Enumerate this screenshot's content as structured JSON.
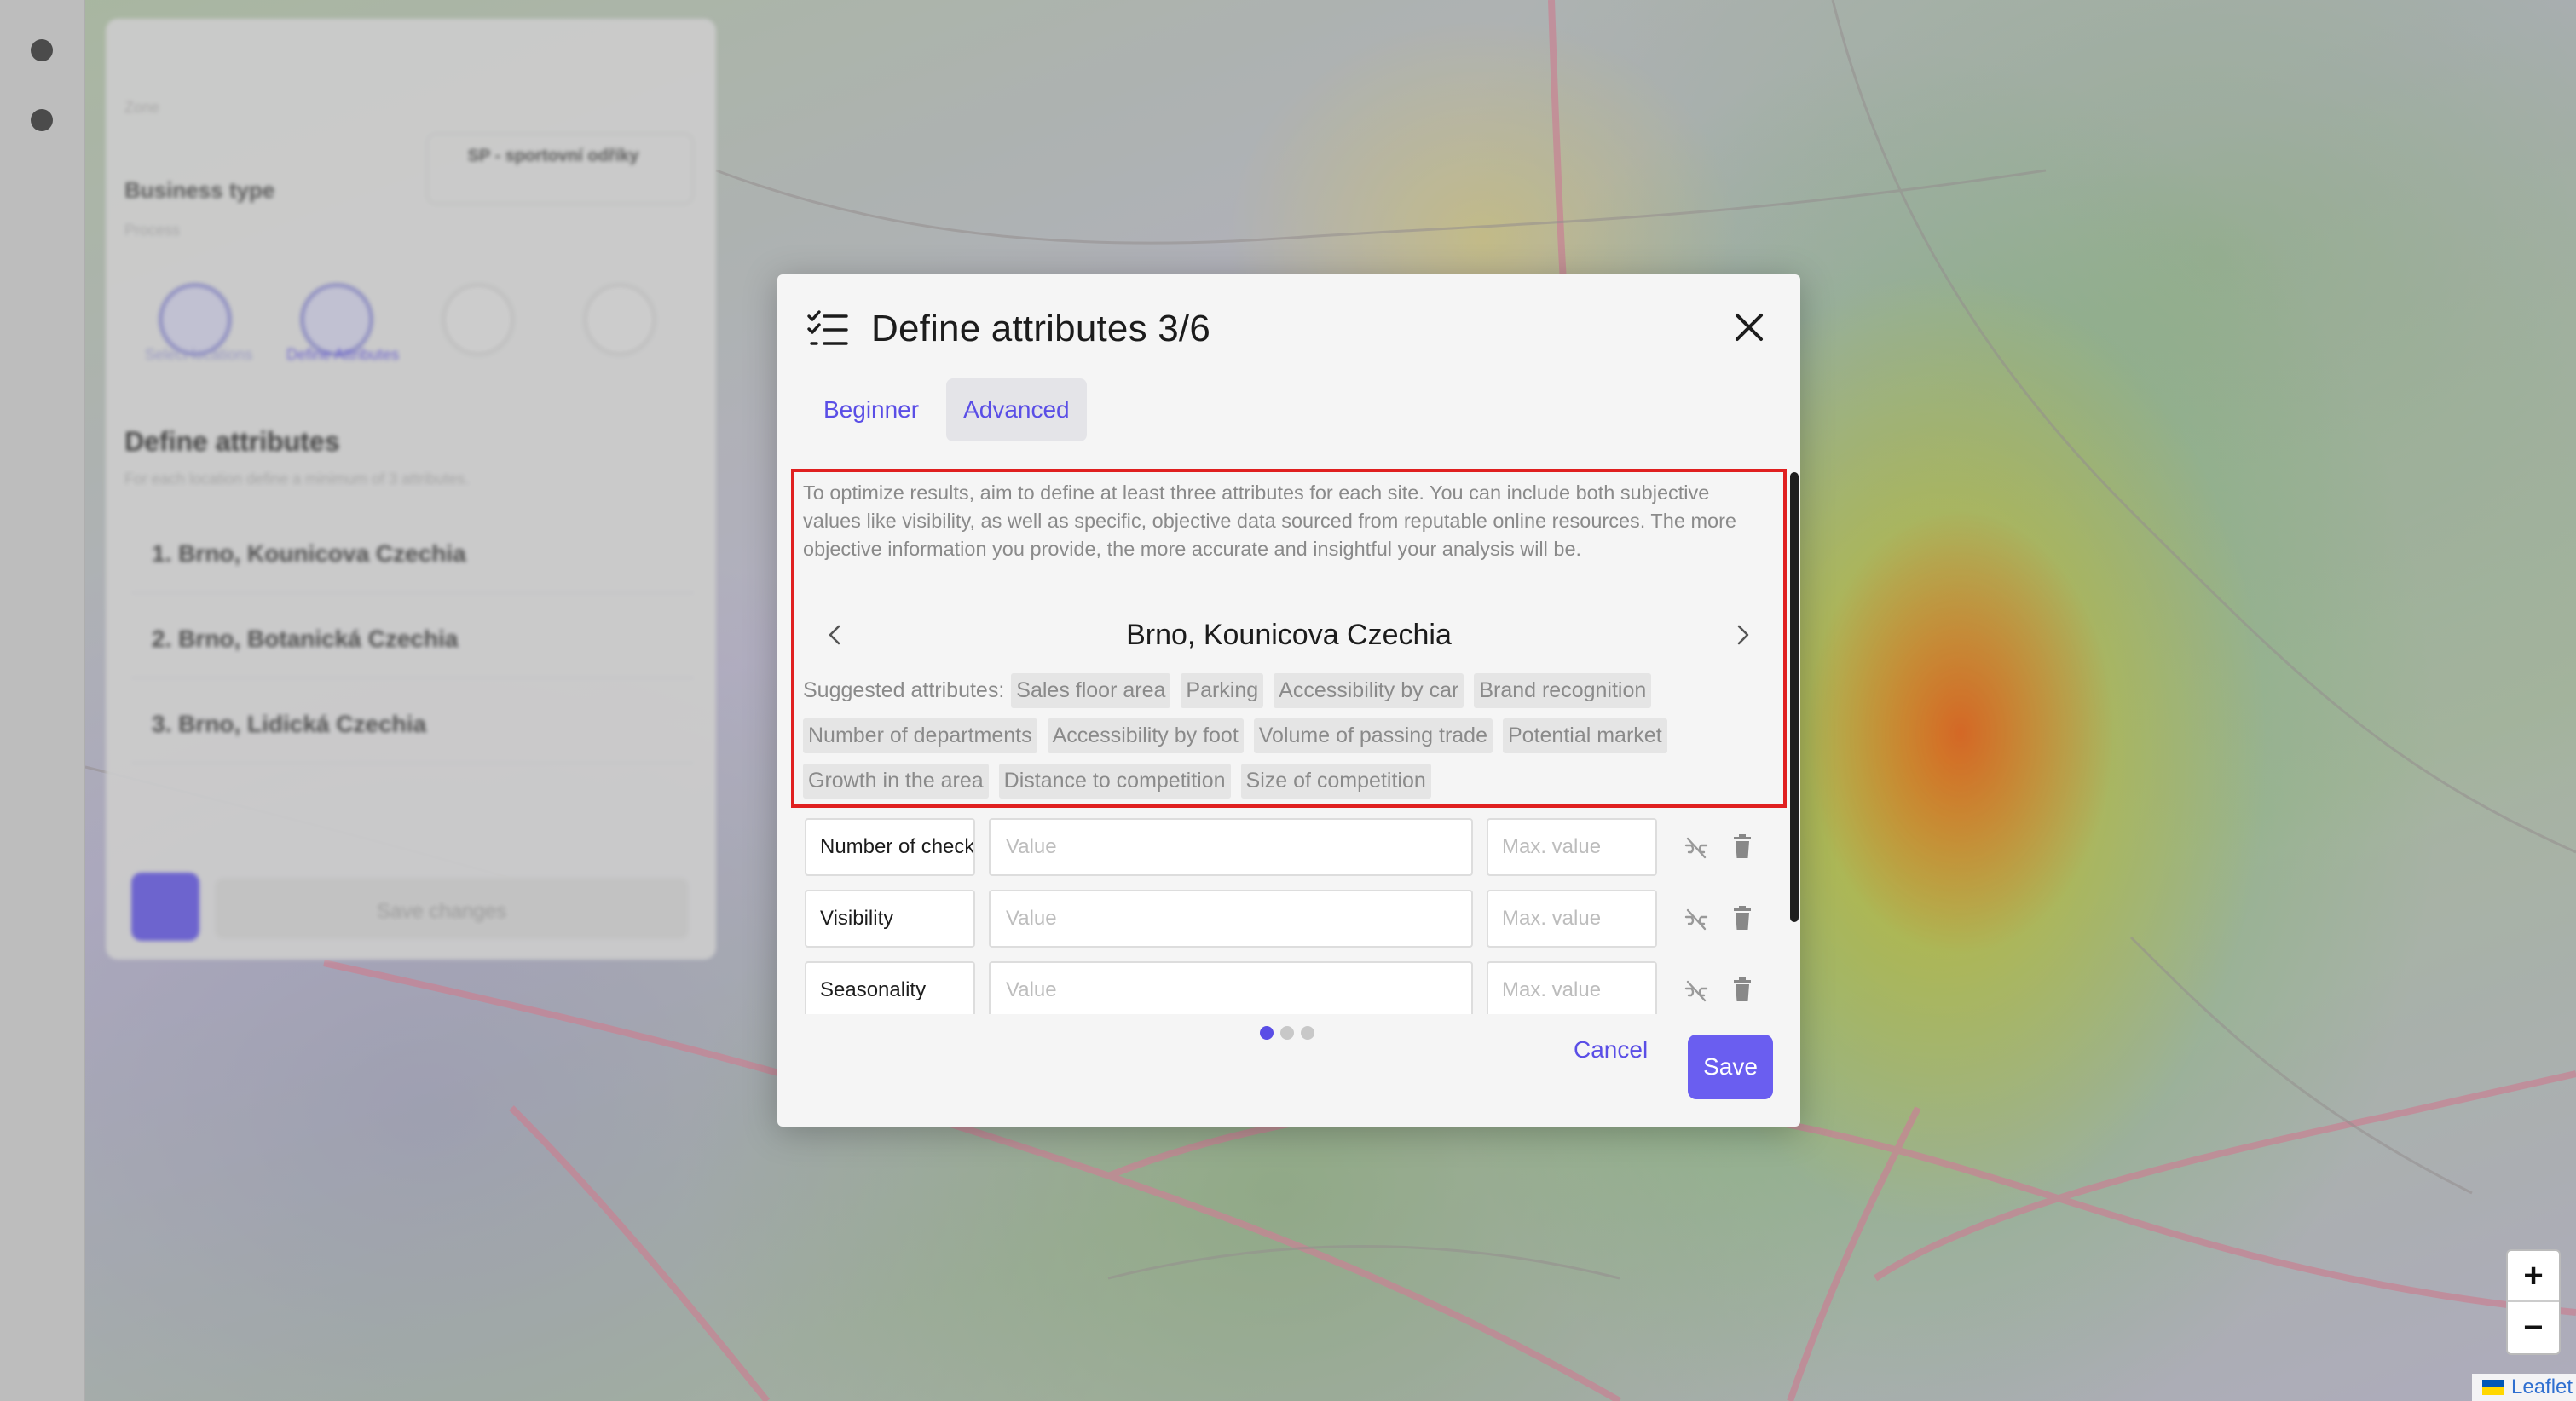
{
  "background_panel": {
    "field_label": "Zone",
    "business_type_label": "Business type",
    "business_type_value": "SP - sportovní odříky",
    "process_label": "Process",
    "steps": [
      "Select locations",
      "Define Attributes",
      "",
      ""
    ],
    "section_title": "Define attributes",
    "section_subtitle": "For each location define a minimum of 3 attributes.",
    "locations": [
      "1. Brno, Kounicova Czechia",
      "2. Brno, Botanická Czechia",
      "3. Brno, Lidická Czechia"
    ],
    "save_changes_label": "Save changes"
  },
  "modal": {
    "title": "Define attributes 3/6",
    "tabs": [
      {
        "label": "Beginner",
        "active": false
      },
      {
        "label": "Advanced",
        "active": true
      }
    ],
    "info_text": "To optimize results, aim to define at least three attributes for each site. You can include both subjective values like visibility, as well as specific, objective data sourced from reputable online resources. The more objective information you provide, the more accurate and insightful your analysis will be.",
    "site_name": "Brno, Kounicova Czechia",
    "suggested_label": "Suggested attributes:",
    "suggested_attributes": [
      "Sales floor area",
      "Parking",
      "Accessibility by car",
      "Brand recognition",
      "Number of departments",
      "Accessibility by foot",
      "Volume of passing trade",
      "Potential market",
      "Growth in the area",
      "Distance to competition",
      "Size of competition"
    ],
    "attributes": [
      {
        "name": "Number of checkouts",
        "value_placeholder": "Value",
        "max_placeholder": "Max. value"
      },
      {
        "name": "Visibility",
        "value_placeholder": "Value",
        "max_placeholder": "Max. value"
      },
      {
        "name": "Seasonality",
        "value_placeholder": "Value",
        "max_placeholder": "Max. value"
      }
    ],
    "pagination": {
      "pages": 3,
      "current": 1
    },
    "cancel_label": "Cancel",
    "save_label": "Save"
  },
  "map": {
    "zoom_in": "+",
    "zoom_out": "−",
    "attribution": "Leaflet"
  },
  "colors": {
    "accent": "#6a5ef0",
    "highlight_border": "#e02020"
  }
}
